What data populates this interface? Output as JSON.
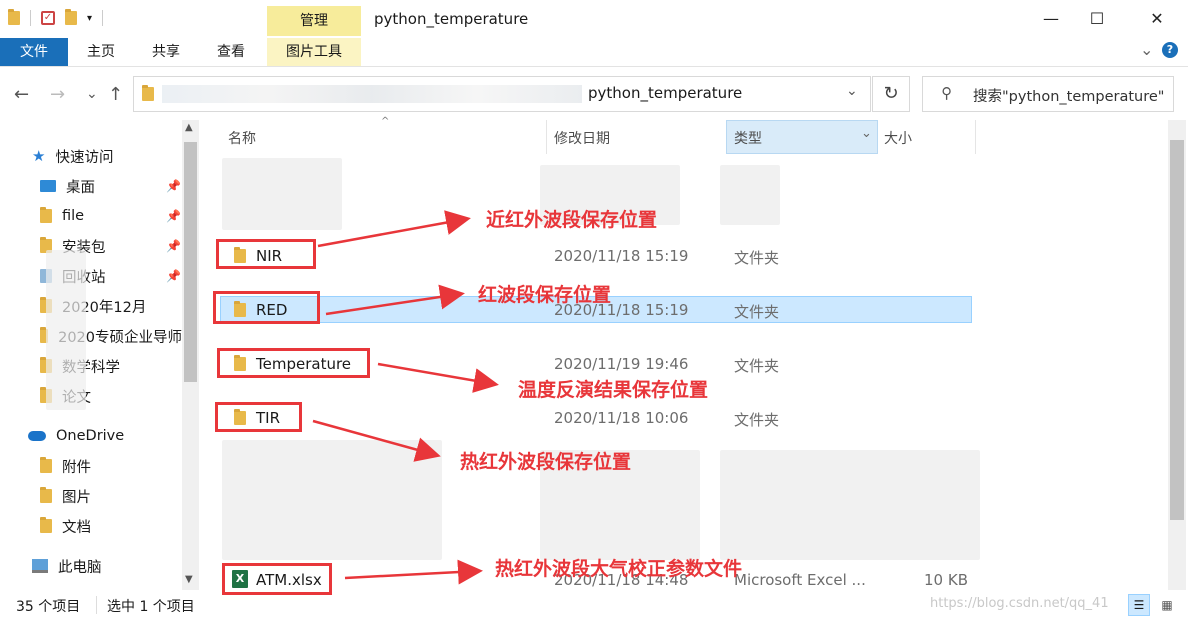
{
  "window": {
    "title": "python_temperature",
    "manage_tab": "管理",
    "minimize": "—",
    "maximize": "☐",
    "close": "✕"
  },
  "ribbon": {
    "tabs": [
      "文件",
      "主页",
      "共享",
      "查看",
      "图片工具"
    ],
    "expand": "⌄",
    "help": "?"
  },
  "nav": {
    "back": "←",
    "forward": "→",
    "recent": "⌄",
    "up": "↑",
    "path_current": "python_temperature",
    "dropdown": "⌄",
    "refresh": "↻",
    "search_placeholder": "搜索\"python_temperature\""
  },
  "sidebar": {
    "items": [
      {
        "label": "快速访问",
        "icon": "star-icon",
        "pinned": false
      },
      {
        "label": "桌面",
        "icon": "desktop-icon",
        "pinned": true
      },
      {
        "label": "file",
        "icon": "folder-icon",
        "pinned": true
      },
      {
        "label": "安装包",
        "icon": "folder-icon",
        "pinned": true
      },
      {
        "label": "回收站",
        "icon": "recycle-bin-icon",
        "pinned": true
      },
      {
        "label": "2020年12月",
        "icon": "folder-icon",
        "pinned": false
      },
      {
        "label": "2020专硕企业导师",
        "icon": "folder-icon",
        "pinned": false
      },
      {
        "label": "数学科学",
        "icon": "folder-icon",
        "pinned": false
      },
      {
        "label": "论文",
        "icon": "folder-icon",
        "pinned": false
      },
      {
        "label": "OneDrive",
        "icon": "cloud-icon",
        "pinned": false
      },
      {
        "label": "附件",
        "icon": "folder-icon",
        "pinned": false
      },
      {
        "label": "图片",
        "icon": "folder-icon",
        "pinned": false
      },
      {
        "label": "文档",
        "icon": "folder-icon",
        "pinned": false
      },
      {
        "label": "此电脑",
        "icon": "computer-icon",
        "pinned": false
      }
    ],
    "pin_glyph": "📌"
  },
  "columns": {
    "name": "名称",
    "date": "修改日期",
    "type": "类型",
    "size": "大小"
  },
  "files": [
    {
      "name": "NIR",
      "date": "2020/11/18 15:19",
      "type": "文件夹",
      "size": ""
    },
    {
      "name": "RED",
      "date": "2020/11/18 15:19",
      "type": "文件夹",
      "size": ""
    },
    {
      "name": "Temperature",
      "date": "2020/11/19 19:46",
      "type": "文件夹",
      "size": ""
    },
    {
      "name": "TIR",
      "date": "2020/11/18 10:06",
      "type": "文件夹",
      "size": ""
    },
    {
      "name": "ATM.xlsx",
      "date": "2020/11/18 14:48",
      "type": "Microsoft Excel ...",
      "size": "10 KB"
    }
  ],
  "annotations": [
    "近红外波段保存位置",
    "红波段保存位置",
    "温度反演结果保存位置",
    "热红外波段保存位置",
    "热红外波段大气校正参数文件"
  ],
  "status": {
    "item_count": "35 个项目",
    "selected": "选中 1 个项目",
    "watermark": "https://blog.csdn.net/qq_41"
  },
  "colors": {
    "accent": "#1a6fb9",
    "selection": "#cce8ff",
    "annotation_red": "#e8363a",
    "manage_tab": "#f7ec9b"
  }
}
